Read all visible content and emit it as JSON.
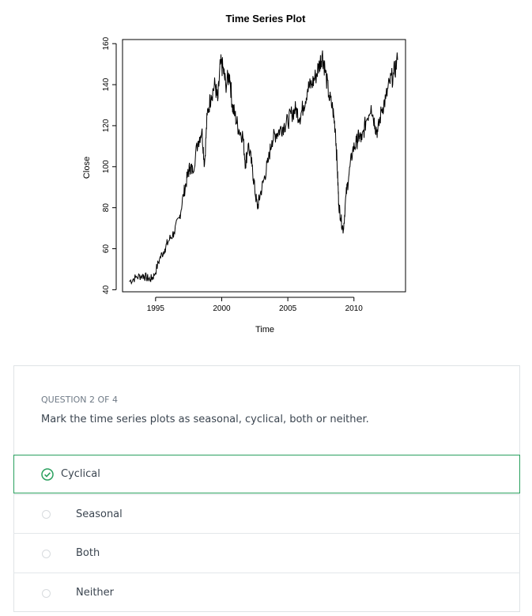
{
  "chart_data": {
    "type": "line",
    "title": "Time Series Plot",
    "xlabel": "Time",
    "ylabel": "Close",
    "xlim": [
      1992.5,
      2013.9
    ],
    "ylim": [
      39,
      162
    ],
    "x_ticks": [
      1995,
      2000,
      2005,
      2010
    ],
    "y_ticks": [
      40,
      60,
      80,
      100,
      120,
      140,
      160
    ],
    "series": [
      {
        "x": [
          1993.0,
          1993.5,
          1994.0,
          1994.3,
          1994.6,
          1994.9,
          1995.3,
          1995.7,
          1996.0,
          1996.4,
          1996.8,
          1997.1,
          1997.4,
          1997.6,
          1997.8,
          1998.2,
          1998.5,
          1998.7,
          1998.9,
          1999.2,
          1999.5,
          1999.7,
          1999.9,
          2000.1,
          2000.3,
          2000.6,
          2000.8,
          2001.0,
          2001.3,
          2001.6,
          2001.8,
          2002.0,
          2002.3,
          2002.5,
          2002.7,
          2002.9,
          2003.2,
          2003.5,
          2003.8,
          2004.1,
          2004.4,
          2004.7,
          2005.0,
          2005.3,
          2005.6,
          2005.9,
          2006.2,
          2006.5,
          2006.8,
          2007.1,
          2007.4,
          2007.6,
          2007.8,
          2008.1,
          2008.4,
          2008.6,
          2008.75,
          2008.85,
          2009.0,
          2009.2,
          2009.4,
          2009.6,
          2009.9,
          2010.2,
          2010.4,
          2010.6,
          2010.9,
          2011.3,
          2011.6,
          2011.8,
          2012.1,
          2012.4,
          2012.7,
          2013.0,
          2013.3
        ],
        "y": [
          44,
          46,
          47,
          46,
          45,
          47,
          55,
          60,
          64,
          68,
          75,
          86,
          95,
          100,
          98,
          112,
          118,
          101,
          125,
          135,
          140,
          132,
          150,
          148,
          140,
          145,
          130,
          125,
          118,
          115,
          101,
          111,
          100,
          89,
          80,
          86,
          94,
          102,
          113,
          116,
          118,
          120,
          122,
          126,
          128,
          124,
          130,
          138,
          140,
          144,
          150,
          155,
          148,
          135,
          128,
          118,
          98,
          82,
          75,
          69,
          86,
          95,
          108,
          112,
          115,
          113,
          122,
          130,
          120,
          117,
          128,
          133,
          141,
          145,
          152
        ]
      }
    ]
  },
  "question": {
    "number_label": "QUESTION 2 OF 4",
    "text": "Mark the time series plots as seasonal, cyclical, both or neither.",
    "options": [
      {
        "label": "Cyclical",
        "selected": true
      },
      {
        "label": "Seasonal",
        "selected": false
      },
      {
        "label": "Both",
        "selected": false
      },
      {
        "label": "Neither",
        "selected": false
      }
    ],
    "colors": {
      "selected_border": "#2aa05e",
      "check": "#2aa05e",
      "text": "#3b4550",
      "muted": "#6f7a86"
    }
  }
}
